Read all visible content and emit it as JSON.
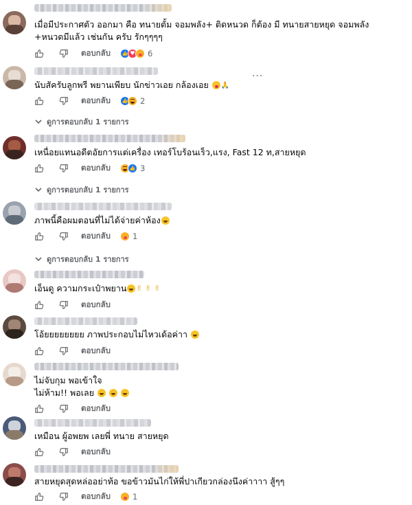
{
  "comments": [
    {
      "text_lines": [
        "เมื่อมีประกาศตัว ออกมา คือ ทนายตั้ม จอมพลัง+ ติดหนวด ก็ต้อง มี ทนายสายหยุด จอมพลัง",
        "+หนวดมีแล้ว เช่นกัน ครับ รักๆๆๆๆ"
      ],
      "reply_label": "ตอบกลับ",
      "reactions": [
        "like",
        "love",
        "care"
      ],
      "reaction_count": "6",
      "avatar_colors": [
        "#8a6a5c",
        "#5a4036",
        "#d9b8a5"
      ]
    },
    {
      "text": "นับสัครับลูกพรี พยานเพียบ นักข่าวเอย กล้องเอย",
      "emojis": [
        "kiss",
        "hands"
      ],
      "reply_label": "ตอบกลับ",
      "reactions": [
        "like",
        "haha"
      ],
      "reaction_count": "2",
      "more_label": "···",
      "view_replies": "ดูการตอบกลับ 1 รายการ",
      "avatar_colors": [
        "#c9b8a8",
        "#7b6557",
        "#e8ddd3"
      ]
    },
    {
      "text": "เหนื่อยแทนอดีตอัยการแต่เครื่อง เทอร์โบร้อนเร็ว,แรง, Fast 12 ท,สายหยุด",
      "reply_label": "ตอบกลับ",
      "reactions": [
        "haha",
        "like"
      ],
      "reaction_count": "3",
      "view_replies": "ดูการตอบกลับ 1 รายการ",
      "avatar_colors": [
        "#6e2e2a",
        "#a55a44",
        "#3a2420"
      ]
    },
    {
      "text": "ภาพนี้คือผมตอนที่ไม่ได้จ่ายค่าห้อง",
      "emojis": [
        "grin"
      ],
      "reply_label": "ตอบกลับ",
      "reactions": [
        "care"
      ],
      "reaction_count": "1",
      "view_replies": "ดูการตอบกลับ 1 รายการ",
      "avatar_colors": [
        "#9aa3ad",
        "#5f6b78",
        "#c8ccd1"
      ]
    },
    {
      "text": "เอ็นดู ความกระเป๋าพยาน",
      "emojis": [
        "grin",
        "v",
        "v",
        "v"
      ],
      "reply_label": "ตอบกลับ",
      "avatar_colors": [
        "#e8c8c4",
        "#b07a74",
        "#f3e2df"
      ]
    },
    {
      "text": "โอ้ยยยยยยยย ภาพประกอบไม่ไหวเด้อค่าา",
      "emojis": [
        "grin"
      ],
      "reply_label": "ตอบกลับ",
      "avatar_colors": [
        "#5c4a3e",
        "#2e241e",
        "#a08674"
      ]
    },
    {
      "text_lines": [
        "ไม่จับกุม พอเข้าใจ",
        "ไม่ห้าม!! พอเลย"
      ],
      "emojis": [
        "grin",
        "grin",
        "grin"
      ],
      "reply_label": "ตอบกลับ",
      "avatar_colors": [
        "#e6d9d0",
        "#b79a88",
        "#f4eee9"
      ]
    },
    {
      "text": "เหมือน ผู้อพยพ เลยพี่ ทนาย สายหยุด",
      "reply_label": "ตอบกลับ",
      "avatar_colors": [
        "#4a5a78",
        "#8a7a68",
        "#cdd3dd"
      ]
    },
    {
      "text": "สายหยุดสุดหล่ออย่าท้อ ขอข้าวมันไก่ให้พี่ปาเกียวกล่องนึงค่าาาา สู้ๆๆ",
      "reply_label": "ตอบกลับ",
      "reactions": [
        "care"
      ],
      "reaction_count": "1",
      "avatar_colors": [
        "#8a4d4a",
        "#c07a6c",
        "#3c2422"
      ]
    }
  ]
}
